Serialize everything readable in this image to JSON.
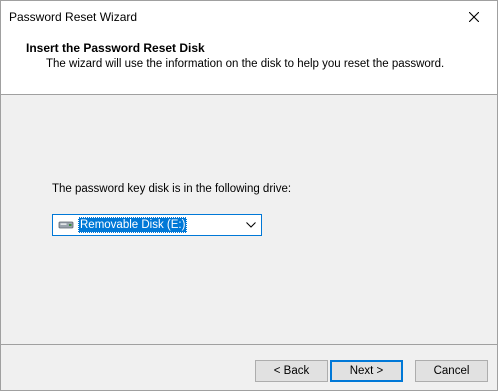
{
  "window": {
    "title": "Password Reset Wizard",
    "close_icon": "close-icon"
  },
  "header": {
    "title": "Insert the Password Reset Disk",
    "subtitle": "The wizard will use the information on the disk to help you reset the password."
  },
  "main": {
    "label": "The password key disk is in the following drive:",
    "drive": {
      "selected": "Removable Disk (E:)",
      "icon": "removable-disk-icon"
    }
  },
  "buttons": {
    "back": "< Back",
    "next": "Next >",
    "cancel": "Cancel"
  },
  "colors": {
    "accent": "#0078d7",
    "window_bg": "#f0f0f0",
    "header_bg": "#ffffff"
  }
}
